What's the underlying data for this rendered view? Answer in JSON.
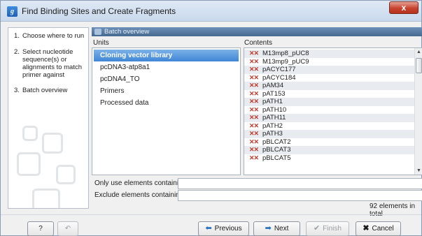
{
  "window": {
    "title": "Find Binding Sites and Create Fragments",
    "app_icon_glyph": "g",
    "close_glyph": "x"
  },
  "steps": [
    {
      "num": "1.",
      "label": "Choose where to run"
    },
    {
      "num": "2.",
      "label": "Select nucleotide\nsequence(s) or\nalignments to match\nprimer against"
    },
    {
      "num": "3.",
      "label": "Batch overview"
    }
  ],
  "panel": {
    "title": "Batch overview",
    "units_header": "Units",
    "contents_header": "Contents"
  },
  "units": [
    {
      "label": "Cloning vector library",
      "selected": true
    },
    {
      "label": "pcDNA3-atp8a1",
      "selected": false
    },
    {
      "label": "pcDNA4_TO",
      "selected": false
    },
    {
      "label": "Primers",
      "selected": false
    },
    {
      "label": "Processed data",
      "selected": false
    }
  ],
  "contents": [
    "M13mp8_pUC8",
    "M13mp9_pUC9",
    "pACYC177",
    "pACYC184",
    "pAM34",
    "pAT153",
    "pATH1",
    "pATH10",
    "pATH11",
    "pATH2",
    "pATH3",
    "pBLCAT2",
    "pBLCAT3",
    "pBLCAT5"
  ],
  "content_icon": "sequence-icon",
  "filters": {
    "include_label": "Only use elements containing:",
    "include_value": "",
    "exclude_label": "Exclude elements containing:",
    "exclude_value": ""
  },
  "count_text": "92 elements in total",
  "buttons": {
    "help": "?",
    "previous": "Previous",
    "next": "Next",
    "finish": "Finish",
    "cancel": "Cancel"
  },
  "colors": {
    "selection": "#3f86d6",
    "sequence_icon": "#c23a2b",
    "panel_title_bar": "#46698f"
  }
}
